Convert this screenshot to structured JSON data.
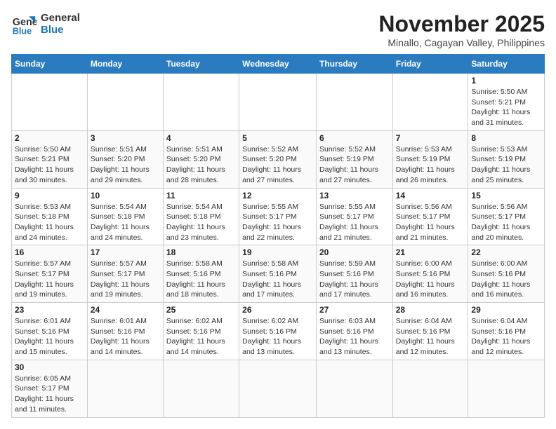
{
  "logo": {
    "line1": "General",
    "line2": "Blue"
  },
  "title": "November 2025",
  "location": "Minallo, Cagayan Valley, Philippines",
  "days_of_week": [
    "Sunday",
    "Monday",
    "Tuesday",
    "Wednesday",
    "Thursday",
    "Friday",
    "Saturday"
  ],
  "weeks": [
    [
      {
        "num": "",
        "info": ""
      },
      {
        "num": "",
        "info": ""
      },
      {
        "num": "",
        "info": ""
      },
      {
        "num": "",
        "info": ""
      },
      {
        "num": "",
        "info": ""
      },
      {
        "num": "",
        "info": ""
      },
      {
        "num": "1",
        "info": "Sunrise: 5:50 AM\nSunset: 5:21 PM\nDaylight: 11 hours\nand 31 minutes."
      }
    ],
    [
      {
        "num": "2",
        "info": "Sunrise: 5:50 AM\nSunset: 5:21 PM\nDaylight: 11 hours\nand 30 minutes."
      },
      {
        "num": "3",
        "info": "Sunrise: 5:51 AM\nSunset: 5:20 PM\nDaylight: 11 hours\nand 29 minutes."
      },
      {
        "num": "4",
        "info": "Sunrise: 5:51 AM\nSunset: 5:20 PM\nDaylight: 11 hours\nand 28 minutes."
      },
      {
        "num": "5",
        "info": "Sunrise: 5:52 AM\nSunset: 5:20 PM\nDaylight: 11 hours\nand 27 minutes."
      },
      {
        "num": "6",
        "info": "Sunrise: 5:52 AM\nSunset: 5:19 PM\nDaylight: 11 hours\nand 27 minutes."
      },
      {
        "num": "7",
        "info": "Sunrise: 5:53 AM\nSunset: 5:19 PM\nDaylight: 11 hours\nand 26 minutes."
      },
      {
        "num": "8",
        "info": "Sunrise: 5:53 AM\nSunset: 5:19 PM\nDaylight: 11 hours\nand 25 minutes."
      }
    ],
    [
      {
        "num": "9",
        "info": "Sunrise: 5:53 AM\nSunset: 5:18 PM\nDaylight: 11 hours\nand 24 minutes."
      },
      {
        "num": "10",
        "info": "Sunrise: 5:54 AM\nSunset: 5:18 PM\nDaylight: 11 hours\nand 24 minutes."
      },
      {
        "num": "11",
        "info": "Sunrise: 5:54 AM\nSunset: 5:18 PM\nDaylight: 11 hours\nand 23 minutes."
      },
      {
        "num": "12",
        "info": "Sunrise: 5:55 AM\nSunset: 5:17 PM\nDaylight: 11 hours\nand 22 minutes."
      },
      {
        "num": "13",
        "info": "Sunrise: 5:55 AM\nSunset: 5:17 PM\nDaylight: 11 hours\nand 21 minutes."
      },
      {
        "num": "14",
        "info": "Sunrise: 5:56 AM\nSunset: 5:17 PM\nDaylight: 11 hours\nand 21 minutes."
      },
      {
        "num": "15",
        "info": "Sunrise: 5:56 AM\nSunset: 5:17 PM\nDaylight: 11 hours\nand 20 minutes."
      }
    ],
    [
      {
        "num": "16",
        "info": "Sunrise: 5:57 AM\nSunset: 5:17 PM\nDaylight: 11 hours\nand 19 minutes."
      },
      {
        "num": "17",
        "info": "Sunrise: 5:57 AM\nSunset: 5:17 PM\nDaylight: 11 hours\nand 19 minutes."
      },
      {
        "num": "18",
        "info": "Sunrise: 5:58 AM\nSunset: 5:16 PM\nDaylight: 11 hours\nand 18 minutes."
      },
      {
        "num": "19",
        "info": "Sunrise: 5:58 AM\nSunset: 5:16 PM\nDaylight: 11 hours\nand 17 minutes."
      },
      {
        "num": "20",
        "info": "Sunrise: 5:59 AM\nSunset: 5:16 PM\nDaylight: 11 hours\nand 17 minutes."
      },
      {
        "num": "21",
        "info": "Sunrise: 6:00 AM\nSunset: 5:16 PM\nDaylight: 11 hours\nand 16 minutes."
      },
      {
        "num": "22",
        "info": "Sunrise: 6:00 AM\nSunset: 5:16 PM\nDaylight: 11 hours\nand 16 minutes."
      }
    ],
    [
      {
        "num": "23",
        "info": "Sunrise: 6:01 AM\nSunset: 5:16 PM\nDaylight: 11 hours\nand 15 minutes."
      },
      {
        "num": "24",
        "info": "Sunrise: 6:01 AM\nSunset: 5:16 PM\nDaylight: 11 hours\nand 14 minutes."
      },
      {
        "num": "25",
        "info": "Sunrise: 6:02 AM\nSunset: 5:16 PM\nDaylight: 11 hours\nand 14 minutes."
      },
      {
        "num": "26",
        "info": "Sunrise: 6:02 AM\nSunset: 5:16 PM\nDaylight: 11 hours\nand 13 minutes."
      },
      {
        "num": "27",
        "info": "Sunrise: 6:03 AM\nSunset: 5:16 PM\nDaylight: 11 hours\nand 13 minutes."
      },
      {
        "num": "28",
        "info": "Sunrise: 6:04 AM\nSunset: 5:16 PM\nDaylight: 11 hours\nand 12 minutes."
      },
      {
        "num": "29",
        "info": "Sunrise: 6:04 AM\nSunset: 5:16 PM\nDaylight: 11 hours\nand 12 minutes."
      }
    ],
    [
      {
        "num": "30",
        "info": "Sunrise: 6:05 AM\nSunset: 5:17 PM\nDaylight: 11 hours\nand 11 minutes."
      },
      {
        "num": "",
        "info": ""
      },
      {
        "num": "",
        "info": ""
      },
      {
        "num": "",
        "info": ""
      },
      {
        "num": "",
        "info": ""
      },
      {
        "num": "",
        "info": ""
      },
      {
        "num": "",
        "info": ""
      }
    ]
  ]
}
